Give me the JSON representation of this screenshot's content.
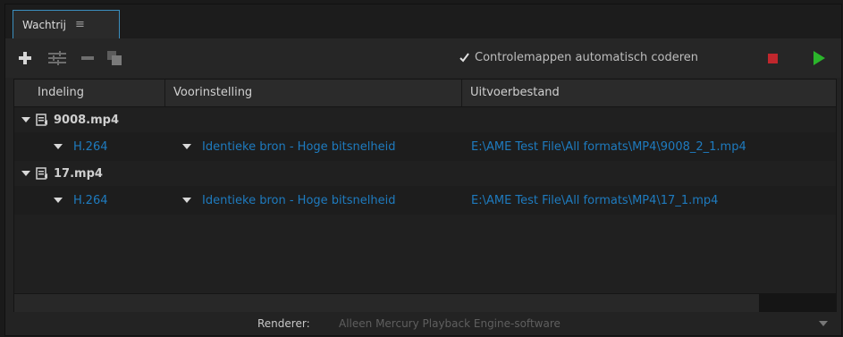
{
  "panel": {
    "tab_label": "Wachtrij",
    "tab_menu_icon": "≡"
  },
  "toolbar": {
    "add_icon": "plus-icon",
    "settings_icon": "sliders-icon",
    "remove_icon": "minus-icon",
    "duplicate_icon": "duplicate-icon",
    "watch_checkbox_checked": true,
    "watch_label": "Controlemappen automatisch coderen",
    "stop_color": "#c0272d",
    "play_color": "#2bb52b"
  },
  "table": {
    "columns": [
      "Indeling",
      "Voorinstelling",
      "Uitvoerbestand"
    ],
    "groups": [
      {
        "name": "9008.mp4",
        "items": [
          {
            "format": "H.264",
            "preset": "Identieke bron - Hoge bitsnelheid",
            "output": "E:\\AME Test File\\All formats\\MP4\\9008_2_1.mp4"
          }
        ]
      },
      {
        "name": "17.mp4",
        "items": [
          {
            "format": "H.264",
            "preset": "Identieke bron - Hoge bitsnelheid",
            "output": "E:\\AME Test File\\All formats\\MP4\\17_1.mp4"
          }
        ]
      }
    ]
  },
  "footer": {
    "renderer_label": "Renderer:",
    "renderer_value": "Alleen Mercury Playback Engine-software"
  },
  "colors": {
    "accent": "#3b8fbf",
    "link": "#1e7bbf"
  }
}
